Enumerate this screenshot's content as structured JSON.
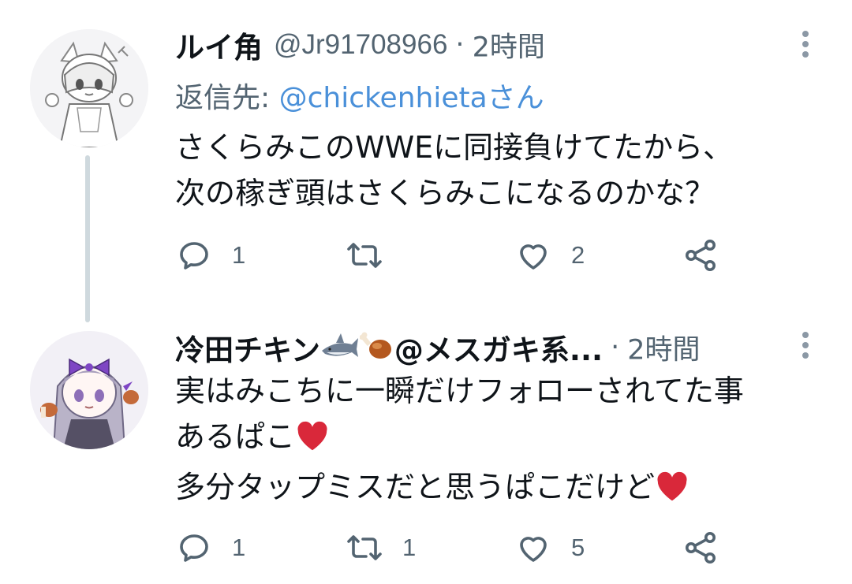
{
  "tweets": [
    {
      "name": "ルイ角",
      "handle": "@Jr91708966",
      "separator": "·",
      "time": "2時間",
      "reply_prefix": "返信先: ",
      "reply_handle": "@chickenhieta",
      "reply_suffix": "さん",
      "text_lines": [
        "さくらみこのWWEに同接負けてたから、",
        "次の稼ぎ頭はさくらみこになるのかな？"
      ],
      "actions": {
        "reply_count": "1",
        "retweet_count": "",
        "like_count": "2"
      }
    },
    {
      "name": "冷田チキン",
      "name_suffix": "@メスガキ系...",
      "separator": "·",
      "time": "2時間",
      "text_lines": [
        "実はみこちに一瞬だけフォローされてた事",
        "あるぱこ",
        "多分タップミスだと思うぱこだけど"
      ],
      "actions": {
        "reply_count": "1",
        "retweet_count": "1",
        "like_count": "5"
      }
    }
  ],
  "icons": [
    "avatar",
    "more-dots-icon",
    "reply-icon",
    "retweet-icon",
    "like-icon",
    "share-icon",
    "shark-emoji",
    "drumstick-emoji",
    "red-heart-emoji"
  ],
  "colors": {
    "text": "#0f1419",
    "secondary": "#536471",
    "link": "#4a90d9",
    "thread_line": "#cfd9de",
    "heart": "#d9283a"
  }
}
